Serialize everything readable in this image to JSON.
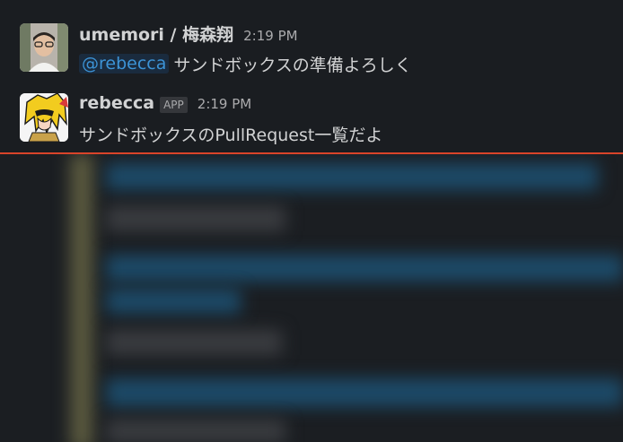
{
  "messages": [
    {
      "sender": "umemori / 梅森翔",
      "time": "2:19 PM",
      "mention": "@rebecca",
      "text": "サンドボックスの準備よろしく",
      "avatar_icon": "user-photo-avatar"
    },
    {
      "sender": "rebecca",
      "badge": "APP",
      "time": "2:19 PM",
      "text": "サンドボックスのPullRequest一覧だよ",
      "avatar_icon": "anime-character-avatar"
    }
  ],
  "colors": {
    "background": "#1a1d21",
    "text": "#d1d2d3",
    "mention_text": "#3c93d6",
    "mention_bg": "#1a2b3e",
    "divider": "#d9442a"
  }
}
